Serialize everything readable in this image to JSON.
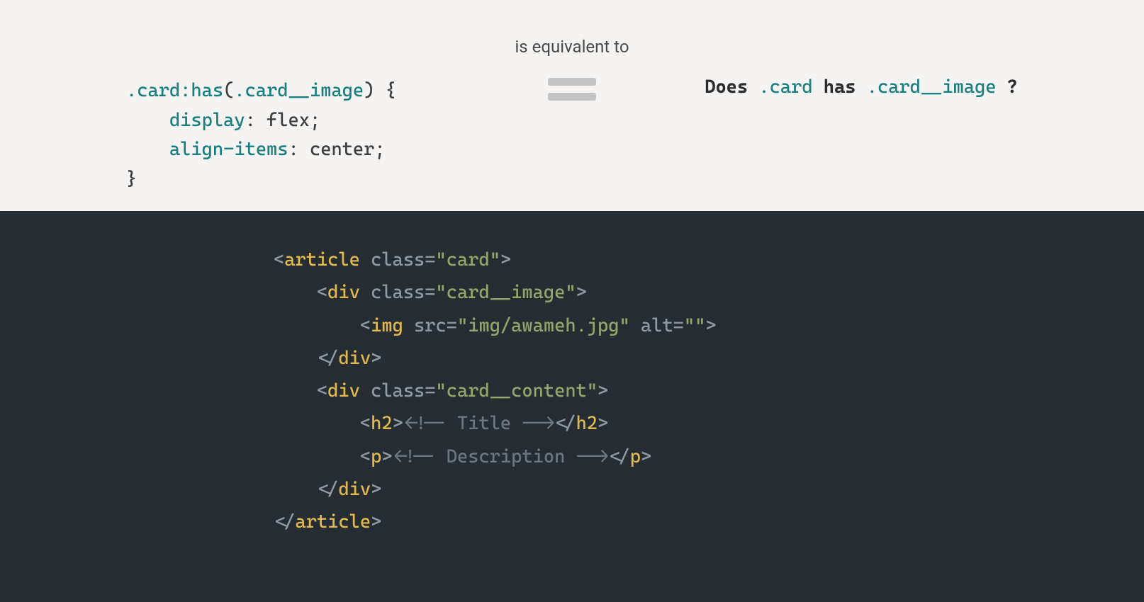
{
  "equivalence_label": "is equivalent to",
  "css": {
    "selector": ".card",
    "pseudo": ":has",
    "arg": ".card__image",
    "prop1": "display",
    "val1": "flex",
    "prop2": "align-items",
    "val2": "center"
  },
  "question": {
    "does": "Does",
    "sel": ".card",
    "has": " has ",
    "arg": ".card__image",
    "q": "?"
  },
  "html": {
    "tag_article": "article",
    "tag_div": "div",
    "tag_img": "img",
    "tag_h2": "h2",
    "tag_p": "p",
    "attr_class": "class",
    "attr_src": "src",
    "attr_alt": "alt",
    "val_card": "\"card\"",
    "val_card_image": "\"card__image\"",
    "val_imgsrc": "\"img/awameh.jpg\"",
    "val_alt": "\"\"",
    "val_card_content": "\"card__content\"",
    "comment_title": "<!-- Title -->",
    "comment_desc": "<!-- Description -->"
  }
}
